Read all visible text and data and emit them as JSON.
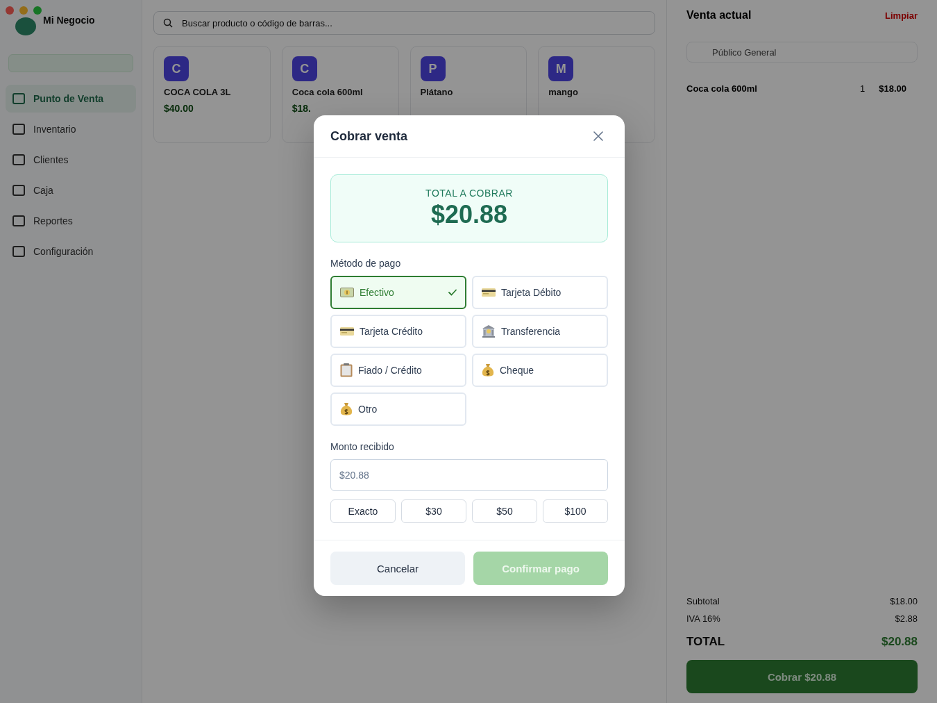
{
  "app": {
    "name": "Mi Negocio"
  },
  "sidebar": {
    "items": [
      {
        "label": "Punto de Venta",
        "selected": true
      },
      {
        "label": "Inventario",
        "selected": false
      },
      {
        "label": "Clientes",
        "selected": false
      },
      {
        "label": "Caja",
        "selected": false
      },
      {
        "label": "Reportes",
        "selected": false
      },
      {
        "label": "Configuración",
        "selected": false
      }
    ]
  },
  "search": {
    "placeholder": "Buscar producto o código de barras..."
  },
  "products": [
    {
      "initial": "C",
      "name": "COCA COLA 3L",
      "price": "$40.00"
    },
    {
      "initial": "C",
      "name": "Coca cola 600ml",
      "price": "$18."
    },
    {
      "initial": "P",
      "name": "Plátano"
    },
    {
      "initial": "M",
      "name": "mango"
    }
  ],
  "cart": {
    "title": "Venta actual",
    "clear": "Limpiar",
    "customer": "Público General",
    "items": [
      {
        "name": "Coca cola 600ml",
        "quantity": "1",
        "total": "$18.00"
      }
    ],
    "totals": [
      {
        "label": "Subtotal",
        "value": "$18.00"
      },
      {
        "label": "IVA 16%",
        "value": "$2.88"
      }
    ],
    "grand_total": {
      "label": "TOTAL",
      "value": "$20.88"
    },
    "charge_button": "Cobrar $20.88"
  },
  "modal": {
    "title": "Cobrar venta",
    "total_label": "TOTAL A COBRAR",
    "total": "$20.88",
    "method_label": "Método de pago",
    "methods": [
      {
        "kind": "cash",
        "label": "Efectivo",
        "selected": true
      },
      {
        "kind": "card",
        "label": "Tarjeta Débito",
        "selected": false
      },
      {
        "kind": "card",
        "label": "Tarjeta Crédito",
        "selected": false
      },
      {
        "kind": "bank",
        "label": "Transferencia",
        "selected": false
      },
      {
        "kind": "clipboard",
        "label": "Fiado / Crédito",
        "selected": false
      },
      {
        "kind": "moneybag",
        "label": "Cheque",
        "selected": false
      },
      {
        "kind": "moneybag",
        "label": "Otro",
        "selected": false
      }
    ],
    "amount_label": "Monto recibido",
    "amount_placeholder": "$20.88",
    "quick_amounts": [
      "Exacto",
      "$30",
      "$50",
      "$100"
    ],
    "cancel": "Cancelar",
    "confirm": {
      "label": "Confirmar pago",
      "disabled": true
    }
  }
}
